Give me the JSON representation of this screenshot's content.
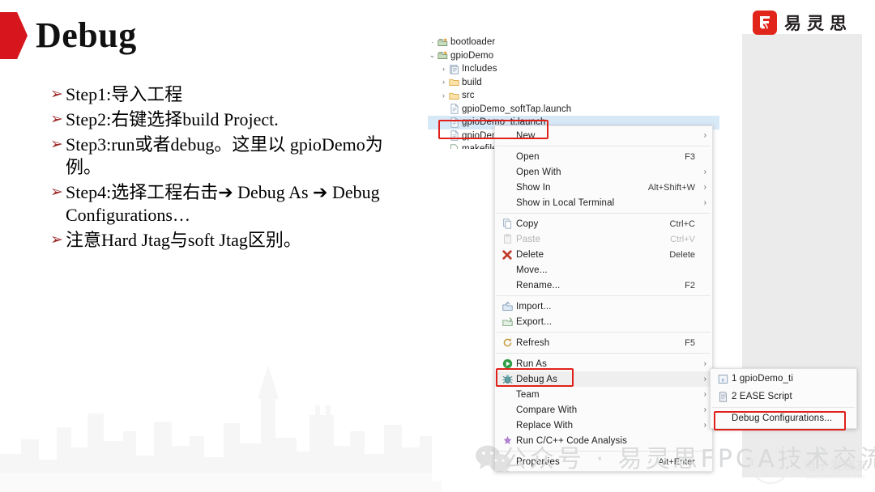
{
  "slide": {
    "title": "Debug",
    "bullets": [
      "Step1:导入工程",
      "Step2:右键选择build Project.",
      "Step3:run或者debug。这里以 gpioDemo为例。",
      "Step4:选择工程右击➔ Debug As ➔ Debug Configurations…",
      "注意Hard Jtag与soft Jtag区别。"
    ],
    "bullet_marker": "➢"
  },
  "logo": {
    "text": "易灵思",
    "color": "#e1251b"
  },
  "explorer": {
    "tree": [
      {
        "label": "bootloader",
        "indent": 0,
        "twisty": "·",
        "icon": "project-icon",
        "selected": false
      },
      {
        "label": "gpioDemo",
        "indent": 0,
        "twisty": "⌄",
        "icon": "project-icon",
        "selected": false
      },
      {
        "label": "Includes",
        "indent": 1,
        "twisty": "›",
        "icon": "includes-icon",
        "selected": false
      },
      {
        "label": "build",
        "indent": 1,
        "twisty": "›",
        "icon": "folder-icon",
        "selected": false
      },
      {
        "label": "src",
        "indent": 1,
        "twisty": "›",
        "icon": "folder-icon",
        "selected": false
      },
      {
        "label": "gpioDemo_softTap.launch",
        "indent": 1,
        "twisty": "",
        "icon": "file-icon",
        "selected": false
      },
      {
        "label": "gpioDemo_ti.launch",
        "indent": 1,
        "twisty": "",
        "icon": "file-icon",
        "selected": true
      },
      {
        "label": "gpioDemo.launch",
        "indent": 1,
        "twisty": "",
        "icon": "file-icon",
        "selected": false
      },
      {
        "label": "makefile",
        "indent": 1,
        "twisty": "",
        "icon": "makefile-icon",
        "selected": false
      }
    ]
  },
  "context_menu": {
    "groups": [
      [
        {
          "label": "New",
          "accel": "",
          "arrow": "›",
          "icon": "",
          "disabled": false,
          "hovered": false
        }
      ],
      [
        {
          "label": "Open",
          "accel": "F3",
          "arrow": "",
          "icon": "",
          "disabled": false,
          "hovered": false
        },
        {
          "label": "Open With",
          "accel": "",
          "arrow": "›",
          "icon": "",
          "disabled": false,
          "hovered": false
        },
        {
          "label": "Show In",
          "accel": "Alt+Shift+W",
          "arrow": "›",
          "icon": "",
          "disabled": false,
          "hovered": false
        },
        {
          "label": "Show in Local Terminal",
          "accel": "",
          "arrow": "›",
          "icon": "",
          "disabled": false,
          "hovered": false
        }
      ],
      [
        {
          "label": "Copy",
          "accel": "Ctrl+C",
          "arrow": "",
          "icon": "copy-icon",
          "disabled": false,
          "hovered": false
        },
        {
          "label": "Paste",
          "accel": "Ctrl+V",
          "arrow": "",
          "icon": "paste-icon",
          "disabled": true,
          "hovered": false
        },
        {
          "label": "Delete",
          "accel": "Delete",
          "arrow": "",
          "icon": "delete-icon",
          "disabled": false,
          "hovered": false
        },
        {
          "label": "Move...",
          "accel": "",
          "arrow": "",
          "icon": "",
          "disabled": false,
          "hovered": false
        },
        {
          "label": "Rename...",
          "accel": "F2",
          "arrow": "",
          "icon": "",
          "disabled": false,
          "hovered": false
        }
      ],
      [
        {
          "label": "Import...",
          "accel": "",
          "arrow": "",
          "icon": "import-icon",
          "disabled": false,
          "hovered": false
        },
        {
          "label": "Export...",
          "accel": "",
          "arrow": "",
          "icon": "export-icon",
          "disabled": false,
          "hovered": false
        }
      ],
      [
        {
          "label": "Refresh",
          "accel": "F5",
          "arrow": "",
          "icon": "refresh-icon",
          "disabled": false,
          "hovered": false
        }
      ],
      [
        {
          "label": "Run As",
          "accel": "",
          "arrow": "›",
          "icon": "run-icon",
          "disabled": false,
          "hovered": false
        },
        {
          "label": "Debug As",
          "accel": "",
          "arrow": "›",
          "icon": "debug-icon",
          "disabled": false,
          "hovered": true
        },
        {
          "label": "Team",
          "accel": "",
          "arrow": "›",
          "icon": "",
          "disabled": false,
          "hovered": false
        },
        {
          "label": "Compare With",
          "accel": "",
          "arrow": "›",
          "icon": "",
          "disabled": false,
          "hovered": false
        },
        {
          "label": "Replace With",
          "accel": "",
          "arrow": "›",
          "icon": "",
          "disabled": false,
          "hovered": false
        },
        {
          "label": "Run C/C++ Code Analysis",
          "accel": "",
          "arrow": "",
          "icon": "analysis-icon",
          "disabled": false,
          "hovered": false
        }
      ],
      [
        {
          "label": "Properties",
          "accel": "Alt+Enter",
          "arrow": "",
          "icon": "",
          "disabled": false,
          "hovered": false
        }
      ]
    ]
  },
  "submenu": {
    "groups": [
      [
        {
          "label": "1 gpioDemo_ti",
          "icon": "c-file-icon",
          "accel": "",
          "arrow": ""
        },
        {
          "label": "2 EASE Script",
          "icon": "script-icon",
          "accel": "",
          "arrow": ""
        }
      ],
      [
        {
          "label": "Debug Configurations...",
          "icon": "",
          "accel": "",
          "arrow": ""
        }
      ]
    ]
  },
  "annotations": {
    "highlight_color": "#e0211b"
  },
  "watermark": {
    "main": "公众号 · 易灵思FPGA技术交流",
    "brand": "电子发烧友",
    "url": "www.elecfans.com"
  }
}
